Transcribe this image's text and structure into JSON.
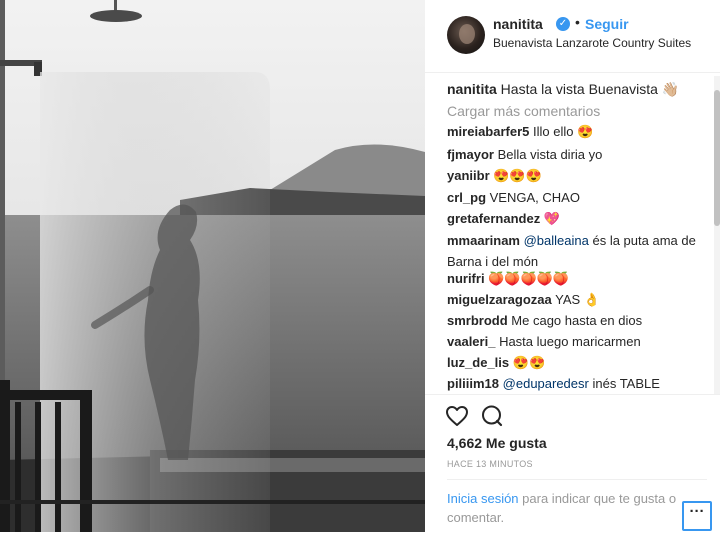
{
  "post": {
    "username": "nanitita",
    "verified_icon": "verified-badge-icon",
    "separator": "•",
    "follow_label": "Seguir",
    "location": "Buenavista Lanzarote Country Suites"
  },
  "caption": {
    "username": "nanitita",
    "text": "Hasta la vista Buenavista 👋🏼"
  },
  "load_more_label": "Cargar más comentarios",
  "comments": [
    {
      "user": "mireiabarfer5",
      "text": "Illo ello 😍"
    },
    {
      "user": "fjmayor",
      "text": "Bella vista diria yo"
    },
    {
      "user": "yaniibr",
      "text": "😍😍😍"
    },
    {
      "user": "crl_pg",
      "text": "VENGA, CHAO"
    },
    {
      "user": "gretafernandez",
      "text": "💖"
    },
    {
      "user": "mmaarinam",
      "mention": "@balleaina",
      "text": "és la puta ama de Barna i del món"
    },
    {
      "user": "nurifri",
      "text": "🍑🍑🍑🍑🍑"
    },
    {
      "user": "miguelzaragozaa",
      "text": "YAS 👌"
    },
    {
      "user": "smrbrodd",
      "text": "Me cago hasta en dios"
    },
    {
      "user": "vaaleri_",
      "text": "Hasta luego maricarmen"
    },
    {
      "user": "luz_de_lis",
      "text": "😍😍"
    },
    {
      "user": "piliiim18",
      "mention": "@eduparedesr",
      "text": "inés TABLE"
    }
  ],
  "actions": {
    "like_icon": "heart-icon",
    "comment_icon": "comment-bubble-icon",
    "likes": "4,662 Me gusta",
    "time": "HACE 13 MINUTOS"
  },
  "login": {
    "link": "Inicia sesión",
    "text": "para indicar que te gusta o comentar.",
    "more_label": "···"
  },
  "colors": {
    "accent": "#3897f0",
    "text": "#262626",
    "muted": "#999999"
  }
}
